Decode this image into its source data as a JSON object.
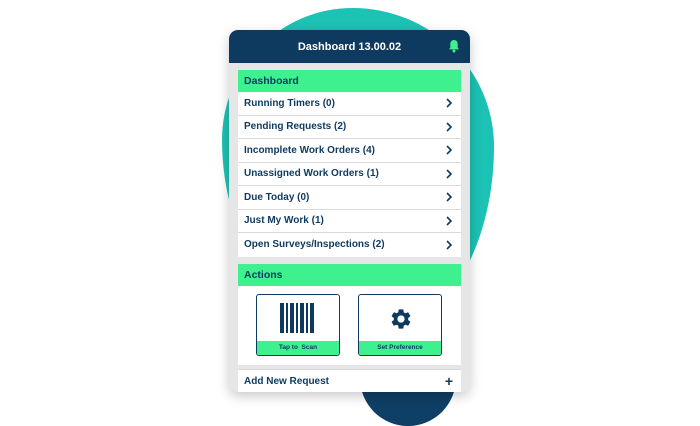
{
  "header": {
    "title": "Dashboard 13.00.02",
    "icon": "bell-icon",
    "bell_color": "#3ff08f"
  },
  "dashboard": {
    "title": "Dashboard",
    "items": [
      {
        "label": "Running Timers (0)"
      },
      {
        "label": "Pending Requests (2)"
      },
      {
        "label": "Incomplete Work Orders (4)"
      },
      {
        "label": "Unassigned Work Orders (1)"
      },
      {
        "label": "Due Today (0)"
      },
      {
        "label": "Just My Work (1)"
      },
      {
        "label": "Open Surveys/Inspections (2)"
      }
    ]
  },
  "actions": {
    "title": "Actions",
    "scan_label": "Tap to  Scan",
    "scan_icon": "barcode-icon",
    "preference_label": "Set Preference",
    "preference_icon": "gear-icon"
  },
  "footer": {
    "add_request_label": "Add New Request",
    "add_icon": "plus-icon"
  },
  "colors": {
    "navy": "#0e3a5f",
    "accent_green": "#3ff08f",
    "teal": "#1cc2b4"
  }
}
